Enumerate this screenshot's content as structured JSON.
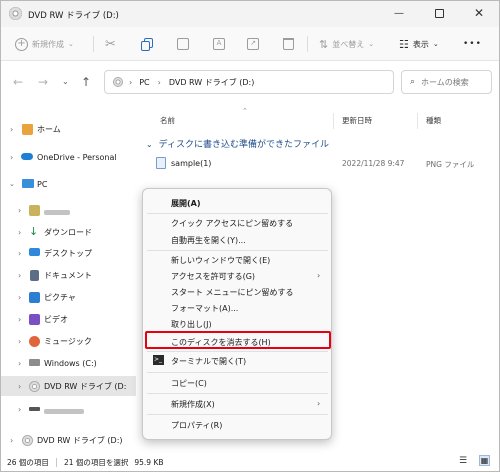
{
  "window": {
    "title": "DVD RW ドライブ (D:)"
  },
  "toolbar": {
    "new_label": "新規作成",
    "sort_label": "並べ替え",
    "view_label": "表示",
    "more_label": "•••"
  },
  "address": {
    "pc": "PC",
    "drive": "DVD RW ドライブ (D:)",
    "search_placeholder": "ホームの検索"
  },
  "nav": {
    "home": "ホーム",
    "onedrive": "OneDrive - Personal",
    "pc": "PC",
    "downloads": "ダウンロード",
    "desktop": "デスクトップ",
    "documents": "ドキュメント",
    "pictures": "ピクチャ",
    "videos": "ビデオ",
    "music": "ミュージック",
    "windows": "Windows (C:)",
    "dvd_selected": "DVD RW ドライブ (D:",
    "dvd": "DVD RW ドライブ (D:)"
  },
  "content": {
    "col_name": "名前",
    "col_date": "更新日時",
    "col_type": "種類",
    "group_title": "ディスクに書き込む準備ができたファイル",
    "file": {
      "name": "sample(1)",
      "date": "2022/11/28 9:47",
      "type": "PNG ファイル"
    }
  },
  "status": {
    "count": "26 個の項目",
    "selected": "21 個の項目を選択",
    "size": "95.9 KB"
  },
  "menu": {
    "expand": "展開(A)",
    "pin_quick": "クイック アクセスにピン留めする",
    "autoplay": "自動再生を開く(Y)...",
    "open_new_window": "新しいウィンドウで開く(E)",
    "give_access": "アクセスを許可する(G)",
    "pin_start": "スタート メニューにピン留めする",
    "format": "フォーマット(A)...",
    "eject": "取り出し(J)",
    "erase": "このディスクを消去する(H)",
    "terminal": "ターミナルで開く(T)",
    "copy": "コピー(C)",
    "new": "新規作成(X)",
    "properties": "プロパティ(R)"
  },
  "colors": {
    "accent": "#1f4e8c",
    "highlight_border": "#e60012"
  }
}
